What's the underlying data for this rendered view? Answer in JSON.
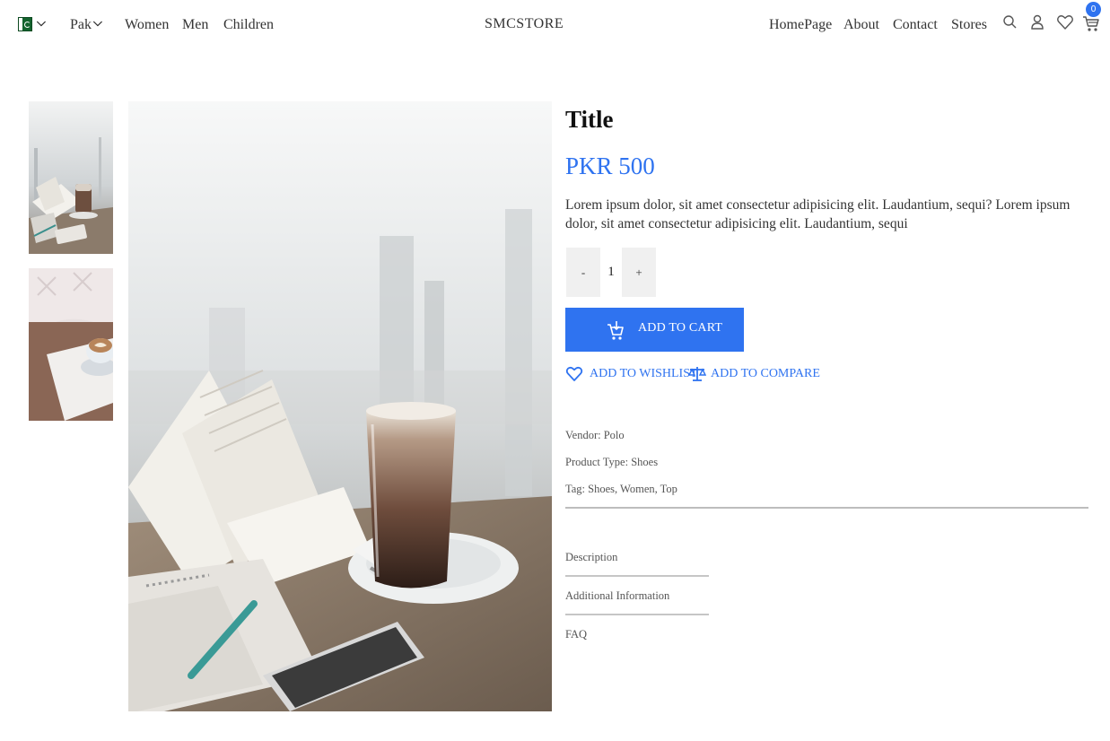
{
  "nav": {
    "country": "Pak",
    "left_links": [
      "Women",
      "Men",
      "Children"
    ],
    "brand": "SMCSTORE",
    "right_links": [
      "HomePage",
      "About",
      "Contact",
      "Stores"
    ],
    "cart_count": "0",
    "icons": [
      "pakistan-flag-icon",
      "search-icon",
      "user-icon",
      "heart-icon",
      "cart-icon"
    ]
  },
  "product": {
    "title": "Title",
    "price": "PKR 500",
    "description": "Lorem ipsum dolor, sit amet consectetur adipisicing elit. Laudantium, sequi? Lorem ipsum dolor, sit amet consectetur adipisicing elit. Laudantium, sequi",
    "quantity": {
      "minus": "-",
      "value": "1",
      "plus": "+"
    },
    "add_to_cart": "ADD TO CART",
    "add_to_wishlist": "ADD TO WISHLIST",
    "add_to_compare": "ADD TO COMPARE",
    "vendor": "Vendor: Polo",
    "product_type": "Product Type: Shoes",
    "tags": "Tag: Shoes, Women, Top"
  },
  "tabs": [
    "Description",
    "Additional Information",
    "FAQ"
  ],
  "colors": {
    "accent": "#2f73f0",
    "qty_bg": "#f0f0f0"
  }
}
